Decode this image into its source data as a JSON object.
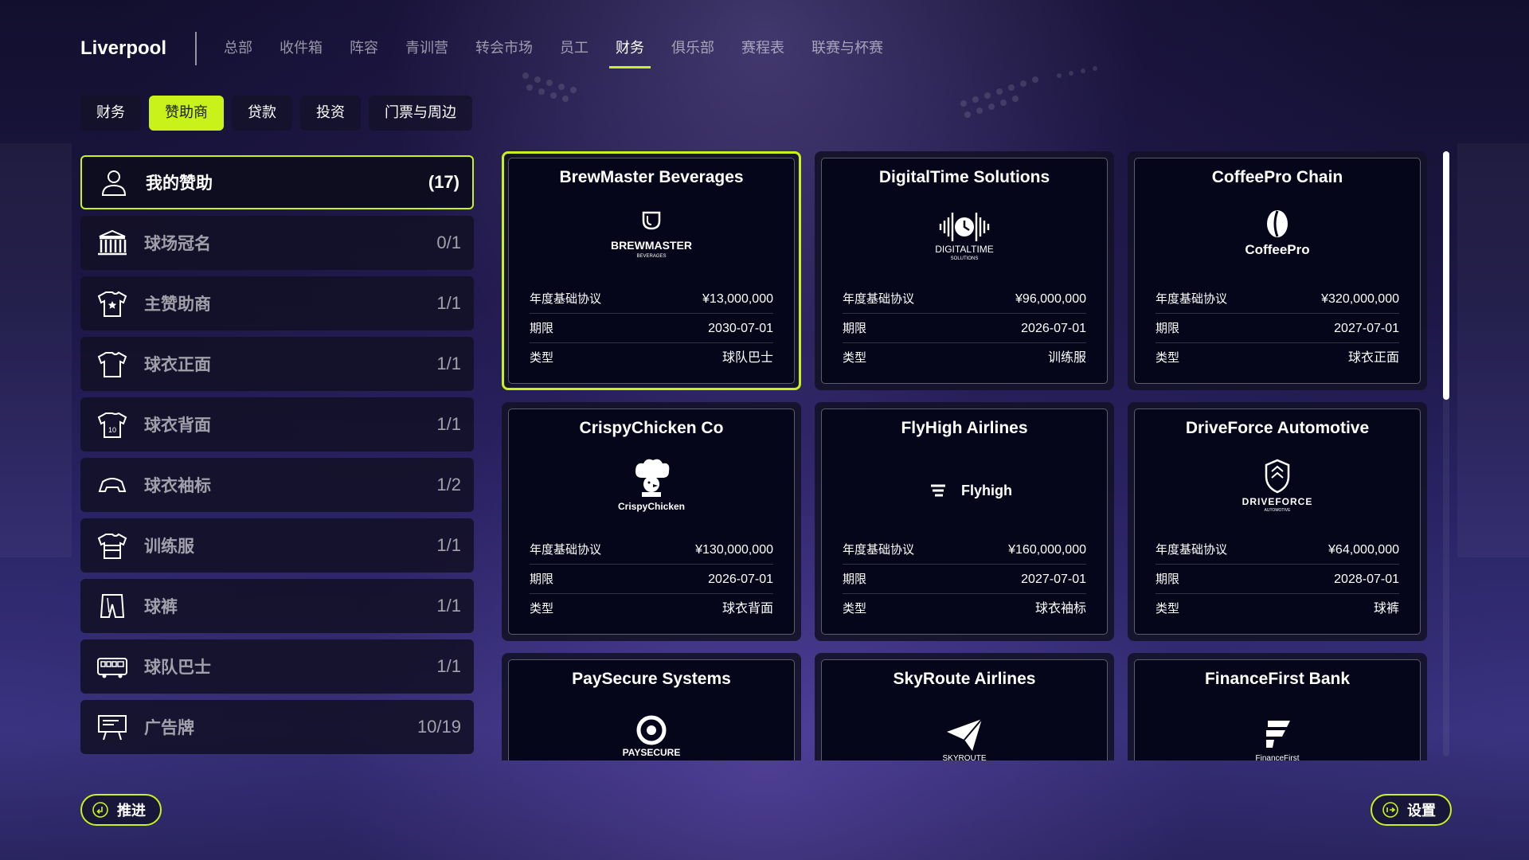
{
  "club": "Liverpool",
  "nav": [
    "总部",
    "收件箱",
    "阵容",
    "青训营",
    "转会市场",
    "员工",
    "财务",
    "俱乐部",
    "赛程表",
    "联赛与杯赛"
  ],
  "nav_active_index": 6,
  "subtabs": [
    "财务",
    "赞助商",
    "贷款",
    "投资",
    "门票与周边"
  ],
  "subtab_active_index": 1,
  "categories": [
    {
      "label": "我的赞助",
      "count": "(17)",
      "icon": "person-icon"
    },
    {
      "label": "球场冠名",
      "count": "0/1",
      "icon": "stadium-icon"
    },
    {
      "label": "主赞助商",
      "count": "1/1",
      "icon": "shirt-star-icon"
    },
    {
      "label": "球衣正面",
      "count": "1/1",
      "icon": "shirt-front-icon"
    },
    {
      "label": "球衣背面",
      "count": "1/1",
      "icon": "shirt-back-icon"
    },
    {
      "label": "球衣袖标",
      "count": "1/2",
      "icon": "sleeve-icon"
    },
    {
      "label": "训练服",
      "count": "1/1",
      "icon": "training-kit-icon"
    },
    {
      "label": "球裤",
      "count": "1/1",
      "icon": "shorts-icon"
    },
    {
      "label": "球队巴士",
      "count": "1/1",
      "icon": "bus-icon"
    },
    {
      "label": "广告牌",
      "count": "10/19",
      "icon": "billboard-icon"
    }
  ],
  "row_labels": {
    "annual": "年度基础协议",
    "term": "期限",
    "type": "类型"
  },
  "sponsors": [
    {
      "name": "BrewMaster Beverages",
      "logo_text": "BREWMASTER",
      "logo_sub": "BEVERAGES",
      "annual": "¥13,000,000",
      "term": "2030-07-01",
      "type": "球队巴士",
      "logo": "mug-logo-icon"
    },
    {
      "name": "DigitalTime Solutions",
      "logo_text": "DIGITALTIME",
      "logo_sub": "SOLUTIONS",
      "annual": "¥96,000,000",
      "term": "2026-07-01",
      "type": "训练服",
      "logo": "clock-wave-logo-icon"
    },
    {
      "name": "CoffeePro Chain",
      "logo_text": "CoffeePro",
      "logo_sub": "",
      "annual": "¥320,000,000",
      "term": "2027-07-01",
      "type": "球衣正面",
      "logo": "coffee-bean-logo-icon"
    },
    {
      "name": "CrispyChicken Co",
      "logo_text": "CrispyChicken",
      "logo_sub": "",
      "annual": "¥130,000,000",
      "term": "2026-07-01",
      "type": "球衣背面",
      "logo": "chef-chicken-logo-icon"
    },
    {
      "name": "FlyHigh Airlines",
      "logo_text": "Flyhigh",
      "logo_sub": "",
      "annual": "¥160,000,000",
      "term": "2027-07-01",
      "type": "球衣袖标",
      "logo": "wing-logo-icon"
    },
    {
      "name": "DriveForce Automotive",
      "logo_text": "DRIVEFORCE",
      "logo_sub": "AUTOMOTIVE",
      "annual": "¥64,000,000",
      "term": "2028-07-01",
      "type": "球裤",
      "logo": "shield-logo-icon"
    },
    {
      "name": "PaySecure Systems",
      "logo_text": "PAYSECURE",
      "logo_sub": "",
      "annual": "",
      "term": "",
      "type": "",
      "logo": "lock-eye-logo-icon"
    },
    {
      "name": "SkyRoute Airlines",
      "logo_text": "SKYROUTE",
      "logo_sub": "",
      "annual": "",
      "term": "",
      "type": "",
      "logo": "paper-plane-logo-icon"
    },
    {
      "name": "FinanceFirst Bank",
      "logo_text": "FinanceFirst",
      "logo_sub": "",
      "annual": "",
      "term": "",
      "type": "",
      "logo": "f-logo-icon"
    }
  ],
  "selected_sponsor_index": 0,
  "buttons": {
    "advance": "推进",
    "settings": "设置"
  },
  "colors": {
    "accent": "#c8f21a",
    "card_bg": "#05061a",
    "panel_bg": "#141228"
  }
}
